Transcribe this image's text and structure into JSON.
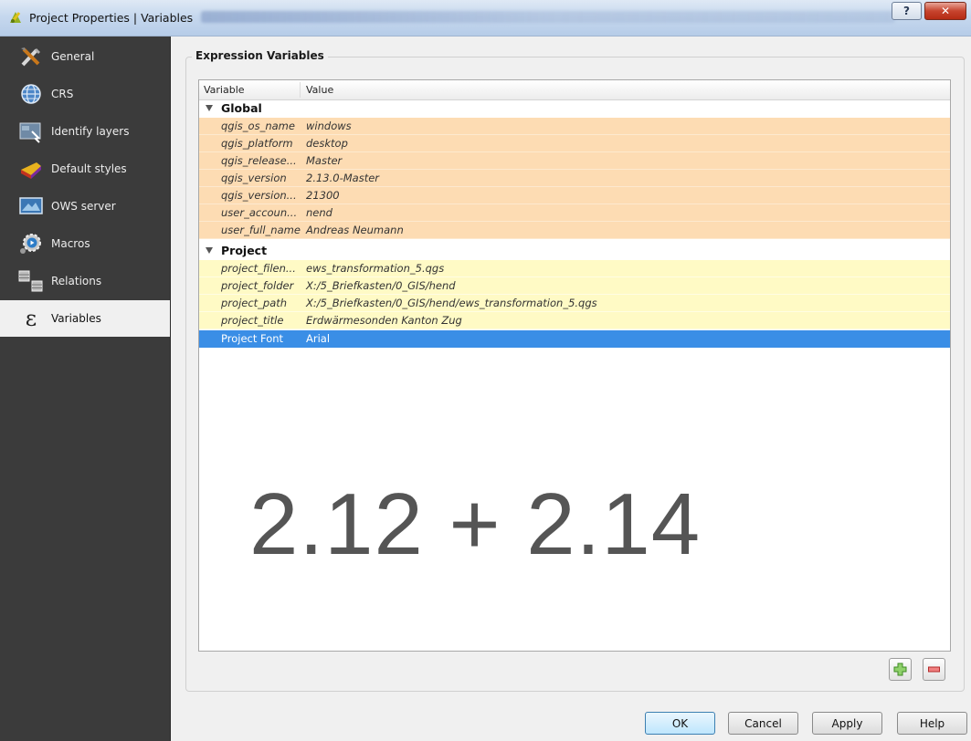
{
  "window": {
    "title": "Project Properties | Variables",
    "help_glyph": "?",
    "close_glyph": "✕"
  },
  "sidebar": {
    "items": [
      {
        "label": "General",
        "icon": "tools-icon"
      },
      {
        "label": "CRS",
        "icon": "globe-icon"
      },
      {
        "label": "Identify layers",
        "icon": "identify-icon"
      },
      {
        "label": "Default styles",
        "icon": "paint-icon"
      },
      {
        "label": "OWS server",
        "icon": "ows-icon"
      },
      {
        "label": "Macros",
        "icon": "macros-icon"
      },
      {
        "label": "Relations",
        "icon": "relations-icon"
      },
      {
        "label": "Variables",
        "icon": "epsilon-icon",
        "glyph": "ε",
        "selected": true
      }
    ]
  },
  "main": {
    "group_title": "Expression Variables",
    "columns": [
      "Variable",
      "Value"
    ],
    "groups": [
      {
        "name": "Global",
        "rows": [
          {
            "variable": "qgis_os_name",
            "value": "windows"
          },
          {
            "variable": "qgis_platform",
            "value": "desktop"
          },
          {
            "variable": "qgis_release...",
            "value": "Master"
          },
          {
            "variable": "qgis_version",
            "value": "2.13.0-Master"
          },
          {
            "variable": "qgis_version...",
            "value": "21300"
          },
          {
            "variable": "user_accoun...",
            "value": "nend"
          },
          {
            "variable": "user_full_name",
            "value": "Andreas Neumann"
          }
        ]
      },
      {
        "name": "Project",
        "rows": [
          {
            "variable": "project_filen...",
            "value": "ews_transformation_5.qgs"
          },
          {
            "variable": "project_folder",
            "value": "X:/5_Briefkasten/0_GIS/hend"
          },
          {
            "variable": "project_path",
            "value": "X:/5_Briefkasten/0_GIS/hend/ews_transformation_5.qgs"
          },
          {
            "variable": "project_title",
            "value": "Erdwärmesonden Kanton Zug"
          },
          {
            "variable": "Project Font",
            "value": "Arial",
            "selected": true
          }
        ]
      }
    ],
    "overlay_text": "2.12 + 2.14",
    "add_variable_icon": "plus-icon",
    "remove_variable_icon": "minus-icon"
  },
  "buttons": {
    "ok": "OK",
    "cancel": "Cancel",
    "apply": "Apply",
    "help": "Help"
  },
  "colors": {
    "global_row": "#fddcb3",
    "project_row": "#fffac5",
    "selection": "#3a8ee6",
    "sidebar": "#3b3b3b"
  }
}
